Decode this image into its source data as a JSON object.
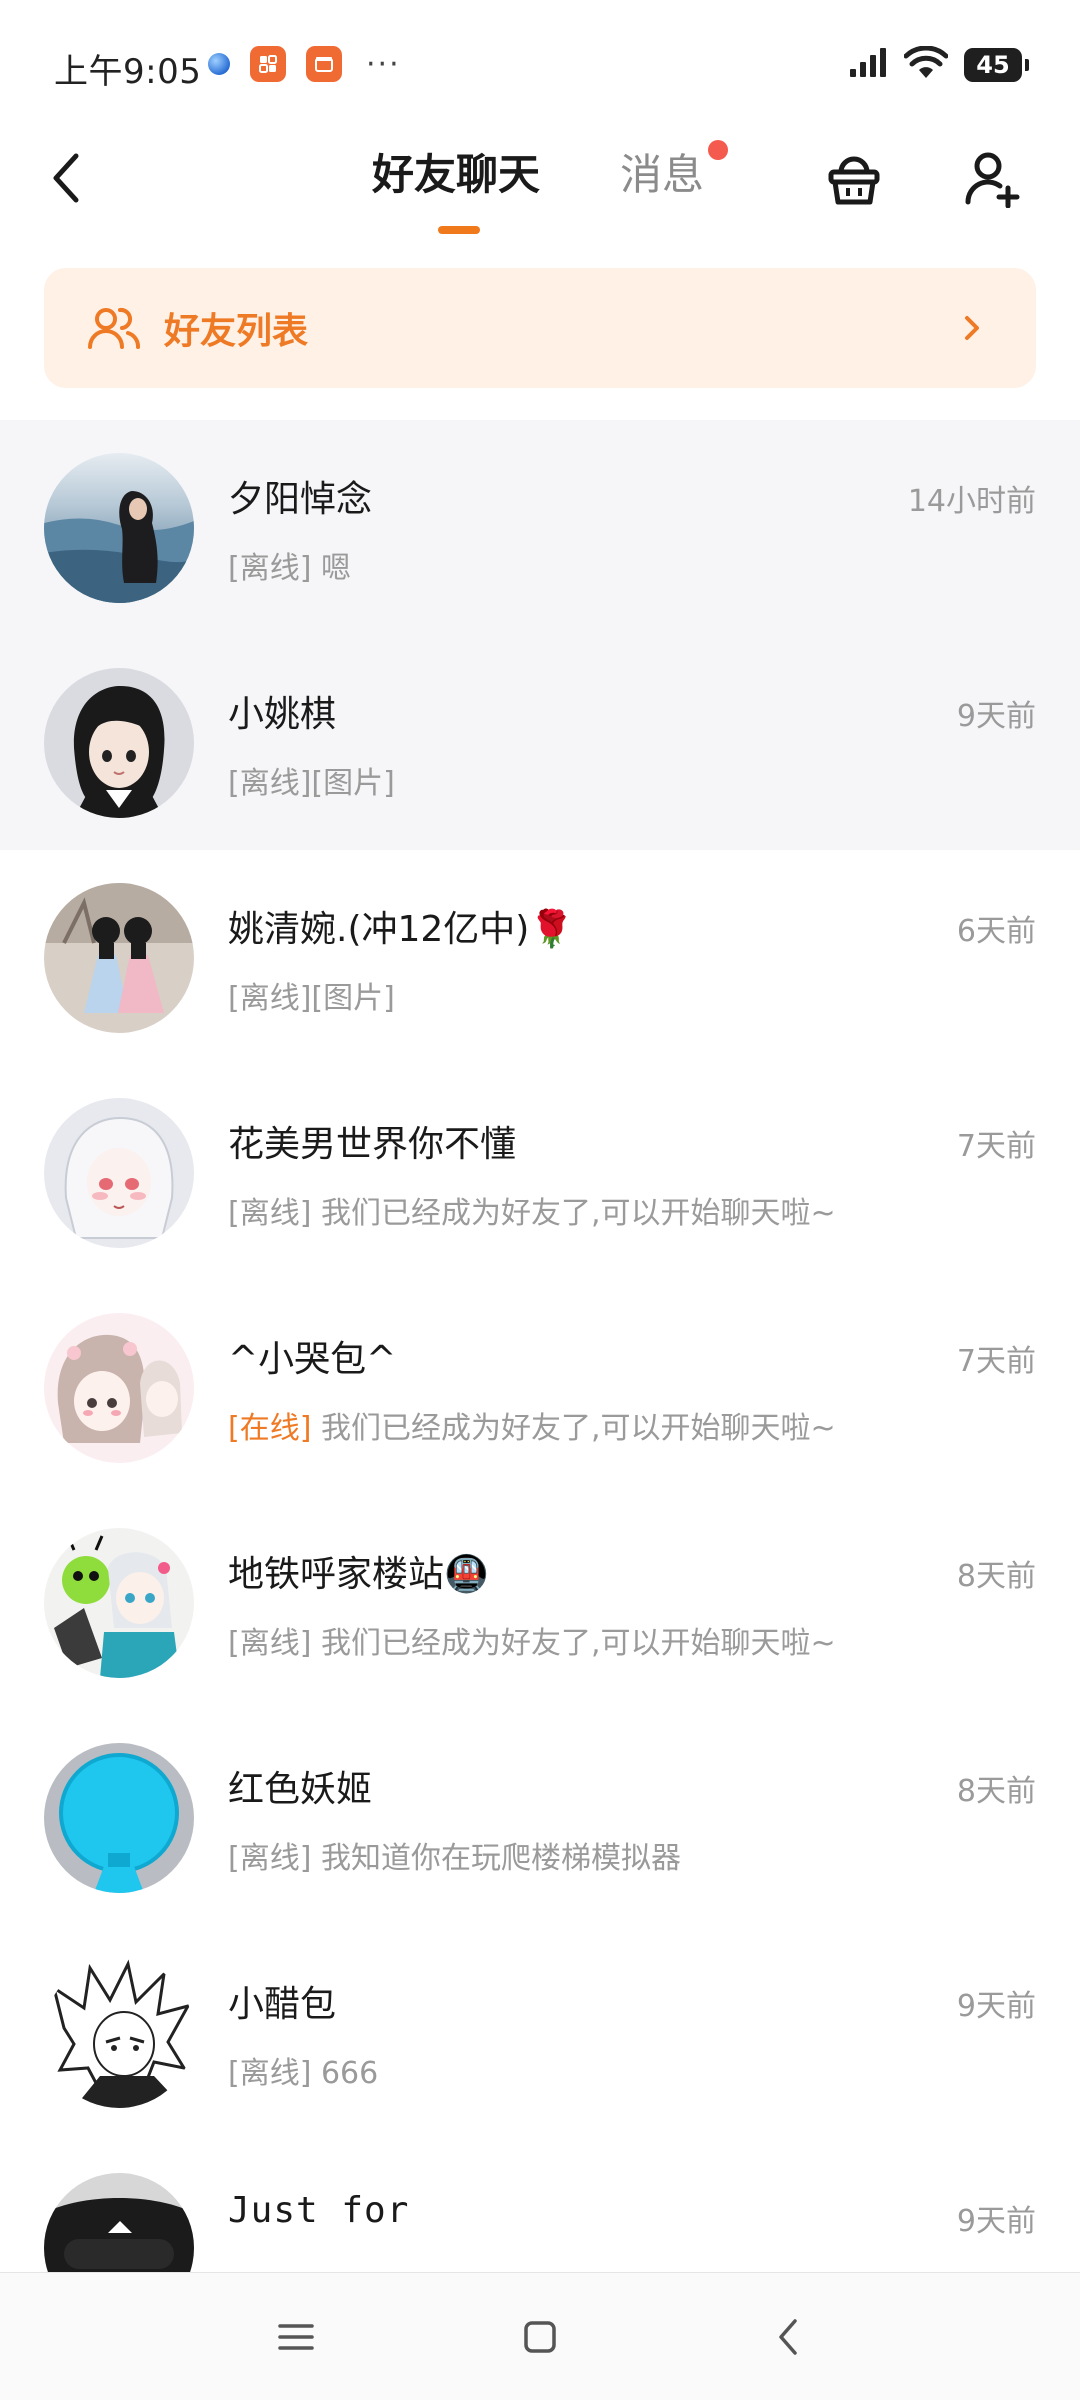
{
  "status_bar": {
    "time": "上午9:05",
    "more": "···",
    "battery": "45",
    "app_icons": [
      "earth-icon",
      "app-orange-icon",
      "shop-orange-icon"
    ]
  },
  "header": {
    "tabs": [
      {
        "label": "好友聊天",
        "active": true
      },
      {
        "label": "消息",
        "active": false,
        "has_dot": true
      }
    ],
    "accent": "#f07a1b",
    "dot_color": "#f55a4e"
  },
  "banner": {
    "label": "好友列表",
    "color": "#ef7a25",
    "background": "#fff1e6"
  },
  "chats": [
    {
      "name": "夕阳悼念",
      "time": "14小时前",
      "status": "[离线]",
      "online": false,
      "preview": "嗯"
    },
    {
      "name": "小姚棋",
      "time": "9天前",
      "status": "[离线]",
      "online": false,
      "preview": "[图片]"
    },
    {
      "name": "姚清婉.(冲12亿中)🌹",
      "time": "6天前",
      "status": "[离线]",
      "online": false,
      "preview": "[图片]"
    },
    {
      "name": "花美男世界你不懂",
      "time": "7天前",
      "status": "[离线]",
      "online": false,
      "preview": "我们已经成为好友了,可以开始聊天啦~"
    },
    {
      "name": "^小哭包^",
      "time": "7天前",
      "status": "[在线]",
      "online": true,
      "preview": "我们已经成为好友了,可以开始聊天啦~"
    },
    {
      "name": "地铁呼家楼站🚇",
      "time": "8天前",
      "status": "[离线]",
      "online": false,
      "preview": "我们已经成为好友了,可以开始聊天啦~"
    },
    {
      "name": "红色妖姬",
      "time": "8天前",
      "status": "[离线]",
      "online": false,
      "preview": "我知道你在玩爬楼梯模拟器"
    },
    {
      "name": "小醋包",
      "time": "9天前",
      "status": "[离线]",
      "online": false,
      "preview": "666"
    },
    {
      "name": "Just for",
      "time": "9天前",
      "status": "",
      "online": false,
      "preview": ""
    }
  ],
  "nav": {
    "icons": [
      "menu-icon",
      "home-icon",
      "back-icon"
    ]
  }
}
